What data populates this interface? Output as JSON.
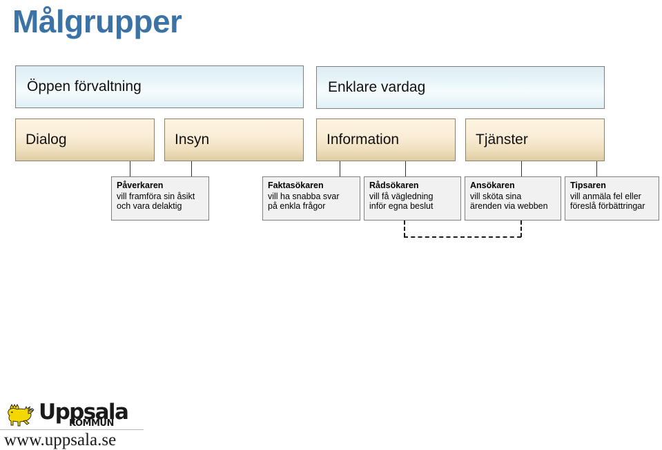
{
  "page": {
    "title": "Målgrupper",
    "title_color": "#3b73a7",
    "background": "#ffffff"
  },
  "level1": [
    {
      "label": "Öppen förvaltning"
    },
    {
      "label": "Enklare vardag"
    }
  ],
  "level2": [
    {
      "label": "Dialog"
    },
    {
      "label": "Insyn"
    },
    {
      "label": "Information"
    },
    {
      "label": "Tjänster"
    }
  ],
  "level3": [
    {
      "title": "Påverkaren",
      "line1": "vill framföra sin åsikt",
      "line2": "och vara delaktig"
    },
    {
      "title": "Faktasökaren",
      "line1": "vill ha snabba svar",
      "line2": "på enkla frågor"
    },
    {
      "title": "Rådsökaren",
      "line1": "vill få vägledning",
      "line2": "inför egna beslut"
    },
    {
      "title": "Ansökaren",
      "line1": "vill sköta sina",
      "line2": "ärenden via webben"
    },
    {
      "title": "Tipsaren",
      "line1": "vill anmäla fel eller",
      "line2": "föreslå förbättringar"
    }
  ],
  "footer": {
    "logo_word": "Uppsala",
    "logo_sub": "KOMMUN",
    "url": "www.uppsala.se",
    "lion_color": "#f5d700"
  },
  "colors": {
    "level1_fill": "#e8f4f8",
    "level2_fill": "#f4e6c8",
    "level3_fill": "#f1f1f1",
    "connector": "#2f2f2f"
  }
}
